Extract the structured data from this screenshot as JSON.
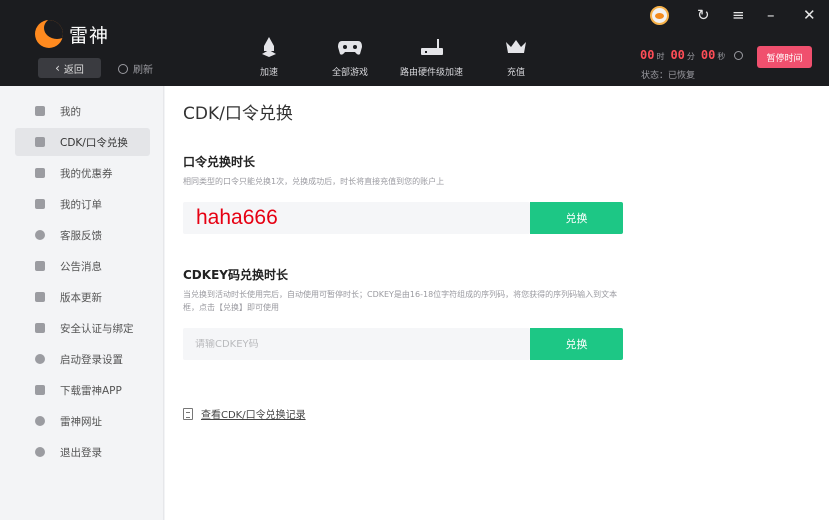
{
  "app": {
    "title": "雷神",
    "back_label": "返回",
    "refresh_label": "刷新"
  },
  "nav": [
    {
      "label": "加速",
      "icon": "rocket-icon"
    },
    {
      "label": "全部游戏",
      "icon": "gamepad-icon"
    },
    {
      "label": "路由硬件级加速",
      "icon": "router-icon"
    },
    {
      "label": "充值",
      "icon": "crown-icon"
    }
  ],
  "window_controls": {
    "icons": [
      "avatar",
      "support-icon",
      "menu-icon",
      "minimize-icon",
      "close-icon"
    ]
  },
  "timer": {
    "hours": "00",
    "hours_unit": "时",
    "minutes": "00",
    "minutes_unit": "分",
    "seconds": "00",
    "seconds_unit": "秒",
    "status": "状态：已恢复",
    "pause_label": "暂停时间"
  },
  "sidebar": {
    "items": [
      {
        "label": "我的",
        "icon": "user-icon"
      },
      {
        "label": "CDK/口令兑换",
        "icon": "gift-icon",
        "active": true
      },
      {
        "label": "我的优惠券",
        "icon": "coupon-icon"
      },
      {
        "label": "我的订单",
        "icon": "order-icon"
      },
      {
        "label": "客服反馈",
        "icon": "service-icon"
      },
      {
        "label": "公告消息",
        "icon": "speaker-icon"
      },
      {
        "label": "版本更新",
        "icon": "update-icon"
      },
      {
        "label": "安全认证与绑定",
        "icon": "shield-icon"
      },
      {
        "label": "启动登录设置",
        "icon": "gear-icon"
      },
      {
        "label": "下载雷神APP",
        "icon": "phone-icon"
      },
      {
        "label": "雷神网址",
        "icon": "globe-icon"
      },
      {
        "label": "退出登录",
        "icon": "logout-icon"
      }
    ]
  },
  "main": {
    "title": "CDK/口令兑换",
    "section1": {
      "title": "口令兑换时长",
      "description": "相同类型的口令只能兑换1次，兑换成功后，时长将直接充值到您的账户上",
      "value": "haha666",
      "button": "兑换"
    },
    "section2": {
      "title": "CDKEY码兑换时长",
      "description": "当兑换到活动时长使用完后，自动使用可暂停时长；CDKEY是由16-18位字符组成的序列码，将您获得的序列码输入到文本框，点击【兑换】即可使用",
      "placeholder": "请输CDKEY码",
      "button": "兑换"
    },
    "record_link": "查看CDK/口令兑换记录"
  },
  "colors": {
    "header_bg": "#1b1c1f",
    "accent_green": "#1dc785",
    "pause_button": "#f0506e",
    "timer_red": "#ff4d57",
    "value_red": "#e60012"
  }
}
